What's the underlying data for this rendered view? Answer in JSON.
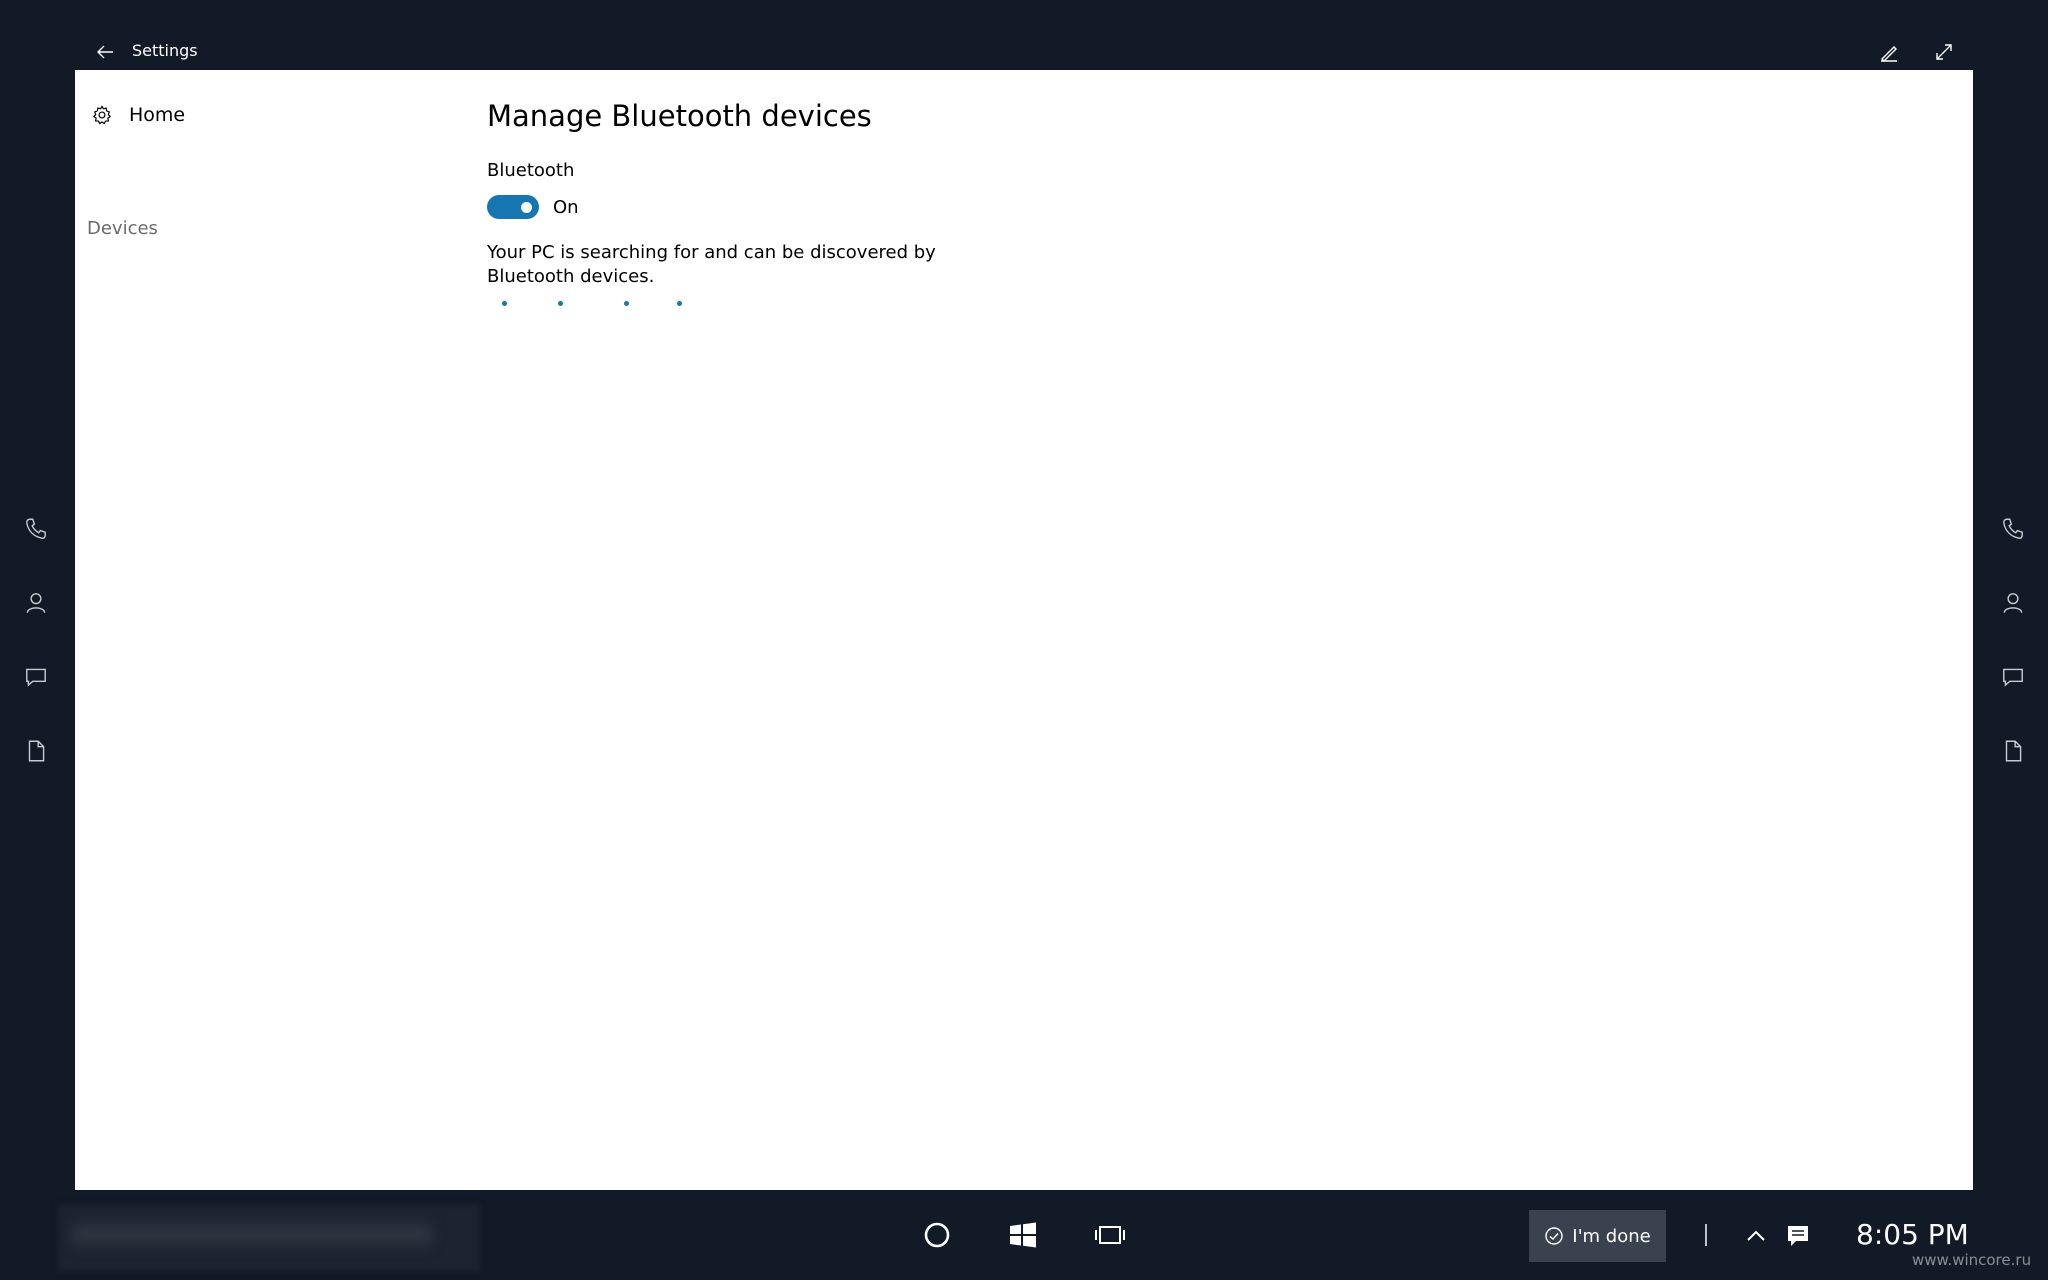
{
  "titlebar": {
    "title": "Settings"
  },
  "nav": {
    "home_label": "Home",
    "section_label": "Devices"
  },
  "content": {
    "page_title": "Manage Bluetooth devices",
    "bluetooth_label": "Bluetooth",
    "toggle_state": "On",
    "toggle_on": true,
    "status_text": "Your PC is searching for and can be discovered by Bluetooth devices."
  },
  "side_rails": {
    "icons": [
      "phone-icon",
      "person-icon",
      "message-icon",
      "document-icon"
    ]
  },
  "taskbar": {
    "done_label": "I'm done",
    "clock": "8:05 PM",
    "icons": [
      "cortana-icon",
      "windows-icon",
      "task-view-icon",
      "chevron-up-icon",
      "action-center-icon"
    ]
  },
  "watermark": "www.wincore.ru",
  "colors": {
    "accent": "#1576b2",
    "background": "#111a26",
    "window": "#ffffff",
    "done_button": "#3a4250"
  }
}
